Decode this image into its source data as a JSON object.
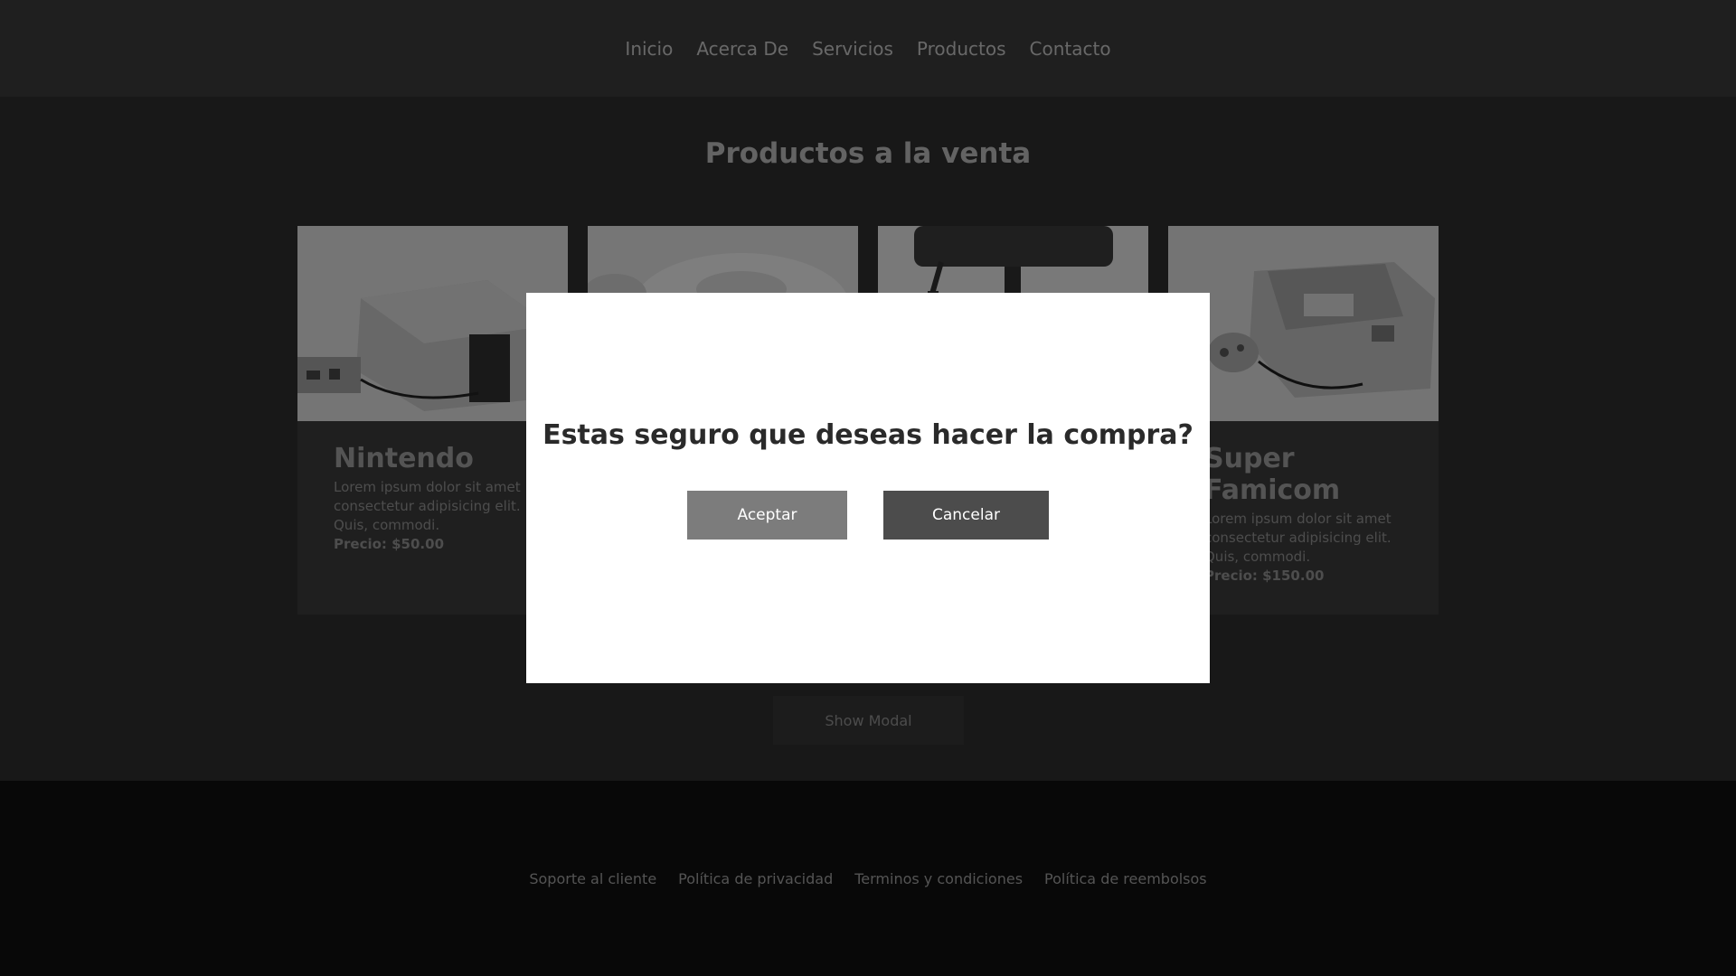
{
  "nav": {
    "items": [
      "Inicio",
      "Acerca De",
      "Servicios",
      "Productos",
      "Contacto"
    ]
  },
  "products": {
    "title": "Productos a la venta",
    "cards": [
      {
        "name": "Nintendo",
        "description": "Lorem ipsum dolor sit amet consectetur adipisicing elit. Quis, commodi.",
        "price": "Precio: $50.00",
        "image_icon": "nes-console-image"
      },
      {
        "name": "",
        "description": "",
        "price": "",
        "image_icon": "dreamcast-console-image"
      },
      {
        "name": "",
        "description": "",
        "price": "",
        "image_icon": "virtual-boy-console-image"
      },
      {
        "name": "Super Famicom",
        "description": "Lorem ipsum dolor sit amet consectetur adipisicing elit. Quis, commodi.",
        "price": "Precio: $150.00",
        "image_icon": "super-famicom-console-image"
      }
    ],
    "show_modal_label": "Show Modal"
  },
  "footer": {
    "links": [
      "Soporte al cliente",
      "Política de privacidad",
      "Terminos y condiciones",
      "Política de reembolsos"
    ]
  },
  "modal": {
    "question": "Estas seguro que deseas hacer la compra?",
    "accept_label": "Aceptar",
    "cancel_label": "Cancelar"
  },
  "colors": {
    "accept_button": "#7c7c7c",
    "cancel_button": "#4c4c4c",
    "modal_background": "#ffffff"
  }
}
